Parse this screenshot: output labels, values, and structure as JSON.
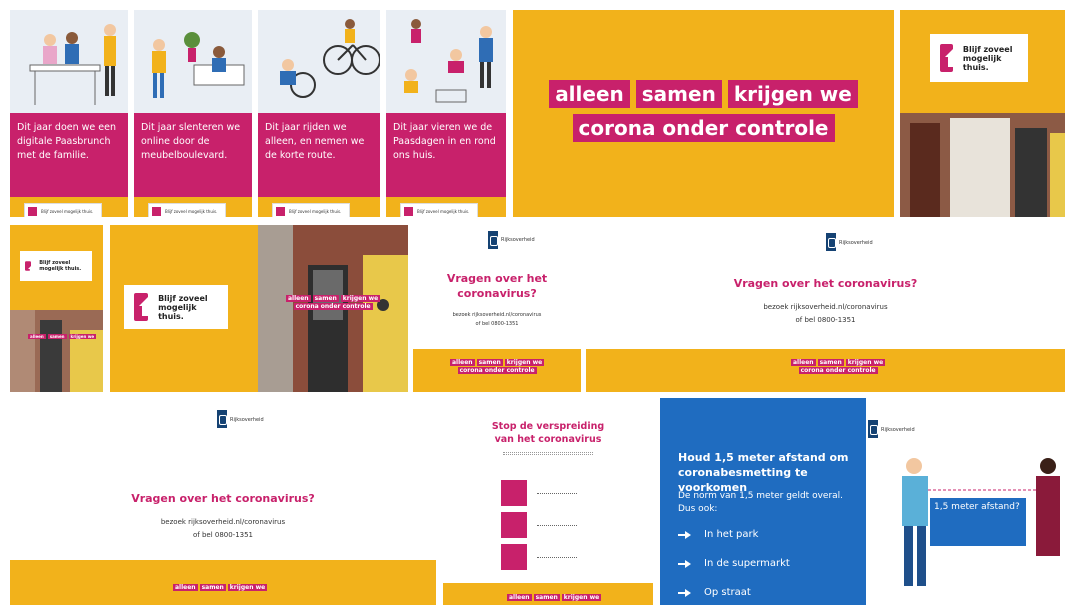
{
  "cards": [
    {
      "text": "Dit jaar doen we een digitale Paasbrunch met de familie."
    },
    {
      "text": "Dit jaar slenteren we online door de meubelboulevard."
    },
    {
      "text": "Dit jaar rijden we alleen, en nemen we de korte route."
    },
    {
      "text": "Dit jaar vieren we de Paasdagen in en rond ons huis."
    }
  ],
  "slogan": {
    "word1": "alleen",
    "word2": "samen",
    "word3": "krijgen we",
    "line2": "corona onder controle"
  },
  "stay_home": "Blijf zoveel mogelijk thuis.",
  "questions": {
    "title": "Vragen over het coronavirus?",
    "title_wrapped_1": "Vragen over het",
    "title_wrapped_2": "coronavirus?",
    "visit": "bezoek rijksoverheid.nl/coronavirus",
    "phone": "of bel 0800-1351"
  },
  "stop": {
    "title_1": "Stop de verspreiding",
    "title_2": "van het coronavirus"
  },
  "distance": {
    "title": "Houd 1,5 meter afstand om coronabesmetting te voorkomen",
    "norm": "De norm van 1,5 meter geldt overal. Dus ook:",
    "items": [
      "In het park",
      "In de supermarkt",
      "Op straat"
    ],
    "bubble": "1,5 meter afstand?"
  },
  "colors": {
    "magenta": "#c8216b",
    "yellow": "#f2b21b",
    "blue": "#1f6cc0",
    "navy": "#154273"
  }
}
